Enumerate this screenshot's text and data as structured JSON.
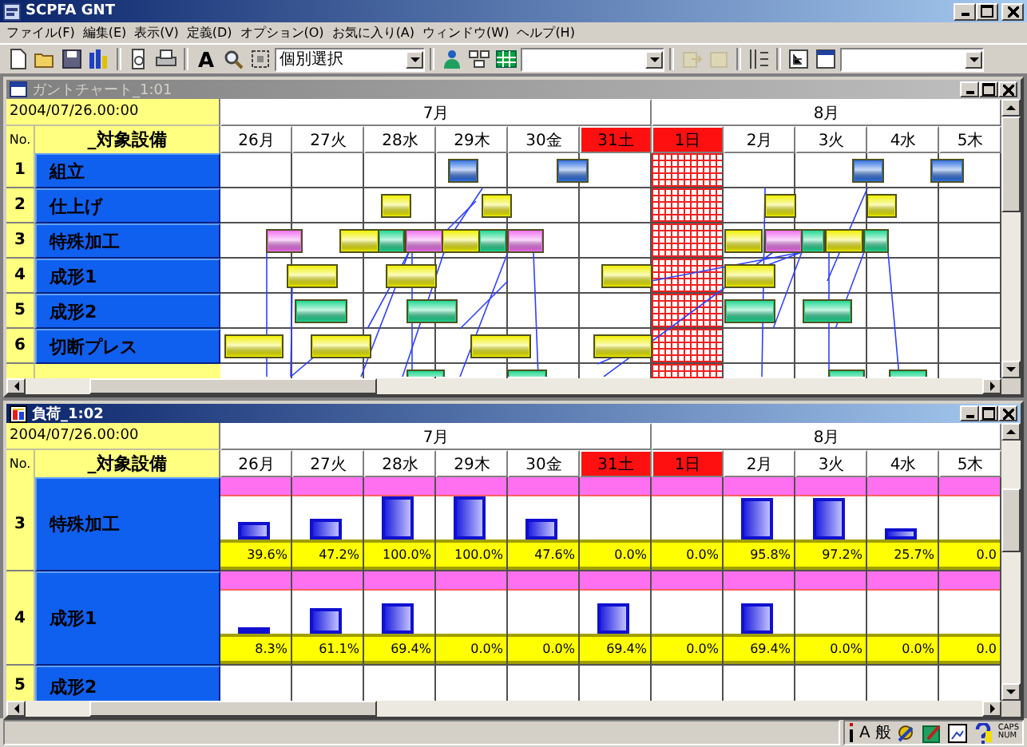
{
  "window": {
    "title": "SCPFA GNT"
  },
  "menu": [
    "ファイル(F)",
    "編集(E)",
    "表示(V)",
    "定義(D)",
    "オプション(O)",
    "お気に入り(A)",
    "ウィンドウ(W)",
    "ヘルプ(H)"
  ],
  "toolbar": [
    {
      "kind": "new",
      "disabled": false
    },
    {
      "kind": "open",
      "disabled": false
    },
    {
      "kind": "save",
      "disabled": false
    },
    {
      "kind": "bars",
      "disabled": false
    },
    {
      "kind": "sep"
    },
    {
      "kind": "preview",
      "disabled": false
    },
    {
      "kind": "print",
      "disabled": false
    },
    {
      "kind": "sep"
    },
    {
      "kind": "font",
      "glyph": "A",
      "disabled": false
    },
    {
      "kind": "find",
      "disabled": false
    },
    {
      "kind": "frame",
      "disabled": false
    },
    {
      "kind": "combo",
      "value": "個別選択"
    },
    {
      "kind": "sep"
    },
    {
      "kind": "person",
      "disabled": false
    },
    {
      "kind": "network",
      "disabled": false
    },
    {
      "kind": "grid",
      "disabled": false
    },
    {
      "kind": "combo"
    },
    {
      "kind": "sep"
    },
    {
      "kind": "forward",
      "disabled": true
    },
    {
      "kind": "doc",
      "disabled": true
    },
    {
      "kind": "sep"
    },
    {
      "kind": "columns",
      "disabled": false
    },
    {
      "kind": "sep"
    },
    {
      "kind": "tree",
      "disabled": false
    },
    {
      "kind": "window",
      "disabled": false
    },
    {
      "kind": "combo"
    }
  ],
  "gantt": {
    "title": "ガントチャート_1:01",
    "active": false,
    "date": "2004/07/26.00:00",
    "no_heading": "No.",
    "name_heading": "_対象設備",
    "months": [
      {
        "label": "7月",
        "days": [
          {
            "label": "26月",
            "holiday": false,
            "closed": false
          },
          {
            "label": "27火",
            "holiday": false,
            "closed": false
          },
          {
            "label": "28水",
            "holiday": false,
            "closed": false
          },
          {
            "label": "29木",
            "holiday": false,
            "closed": false
          },
          {
            "label": "30金",
            "holiday": false,
            "closed": false
          },
          {
            "label": "31土",
            "holiday": true,
            "closed": false
          }
        ]
      },
      {
        "label": "8月",
        "days": [
          {
            "label": "1日",
            "holiday": true,
            "closed": true
          },
          {
            "label": "2月",
            "holiday": false,
            "closed": false
          },
          {
            "label": "3火",
            "holiday": false,
            "closed": false
          },
          {
            "label": "4水",
            "holiday": false,
            "closed": false
          },
          {
            "label": "5木",
            "holiday": false,
            "closed": false
          }
        ]
      }
    ],
    "rows": [
      {
        "no": "1",
        "name": "組立"
      },
      {
        "no": "2",
        "name": "仕上げ"
      },
      {
        "no": "3",
        "name": "特殊加工"
      },
      {
        "no": "4",
        "name": "成形1"
      },
      {
        "no": "5",
        "name": "成形2"
      },
      {
        "no": "6",
        "name": "切断プレス"
      }
    ]
  },
  "load": {
    "title": "負荷_1:02",
    "active": true,
    "date": "2004/07/26.00:00",
    "no_heading": "No.",
    "name_heading": "_対象設備",
    "months": [
      {
        "label": "7月",
        "days": [
          {
            "label": "26月",
            "holiday": false
          },
          {
            "label": "27火",
            "holiday": false
          },
          {
            "label": "28水",
            "holiday": false
          },
          {
            "label": "29木",
            "holiday": false
          },
          {
            "label": "30金",
            "holiday": false
          },
          {
            "label": "31土",
            "holiday": true
          }
        ]
      },
      {
        "label": "8月",
        "days": [
          {
            "label": "1日",
            "holiday": true
          },
          {
            "label": "2月",
            "holiday": false
          },
          {
            "label": "3火",
            "holiday": false
          },
          {
            "label": "4水",
            "holiday": false
          },
          {
            "label": "5木",
            "holiday": false
          }
        ]
      }
    ],
    "rows": [
      {
        "no": "3",
        "name": "特殊加工",
        "cells": [
          {
            "value": "39.6%",
            "level": 0.396
          },
          {
            "value": "47.2%",
            "level": 0.472
          },
          {
            "value": "100.0%",
            "level": 1
          },
          {
            "value": "100.0%",
            "level": 1
          },
          {
            "value": "47.6%",
            "level": 0.476
          },
          {
            "value": "0.0%"
          },
          {
            "value": "0.0%"
          },
          {
            "value": "95.8%",
            "level": 0.958
          },
          {
            "value": "97.2%",
            "level": 0.972
          },
          {
            "value": "25.7%",
            "level": 0.257
          },
          {
            "value": "0.0"
          }
        ]
      },
      {
        "no": "4",
        "name": "成形1",
        "cells": [
          {
            "value": "8.3%",
            "level": 0.083
          },
          {
            "value": "61.1%",
            "level": 0.611
          },
          {
            "value": "69.4%",
            "level": 0.694
          },
          {
            "value": "0.0%"
          },
          {
            "value": "0.0%"
          },
          {
            "value": "69.4%",
            "level": 0.694
          },
          {
            "value": "0.0%"
          },
          {
            "value": "69.4%",
            "level": 0.694
          },
          {
            "value": "0.0%"
          },
          {
            "value": "0.0%"
          },
          {
            "value": "0.0"
          }
        ]
      },
      {
        "no": "5",
        "name": "成形2"
      }
    ]
  },
  "status_bar": {
    "indicators": [
      "A",
      "般"
    ],
    "keys": [
      "CAPS",
      "NUM"
    ]
  }
}
